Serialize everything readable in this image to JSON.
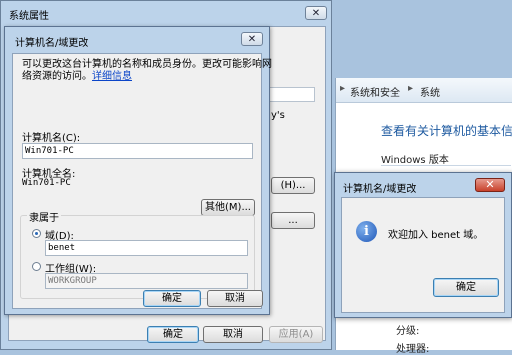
{
  "background_window": {
    "crumbs": [
      "系统和安全",
      "系统"
    ],
    "partial_text": "y's",
    "heading": "查看有关计算机的基本信息",
    "windows_version_label": "Windows 版本",
    "props": [
      "分级:",
      "处理器:"
    ]
  },
  "system_properties": {
    "title": "系统属性",
    "close_glyph": "✕",
    "partial_button_1": "(H)...",
    "partial_button_2": "...",
    "ok_label": "确定",
    "cancel_label": "取消",
    "apply_label": "应用(A)"
  },
  "computer_name_dialog": {
    "title": "计算机名/域更改",
    "close_glyph": "✕",
    "description": "可以更改这台计算机的名称和成员身份。更改可能影响网络资源的访问。",
    "description_line1": "可以更改这台计算机的名称和成员身份。更改可能影响网",
    "description_line2": "络资源的访问。",
    "details_link": "详细信息",
    "computer_name_label": "计算机名(C):",
    "computer_name_value": "Win701-PC",
    "full_name_label": "计算机全名:",
    "full_name_value": "Win701-PC",
    "more_button": "其他(M)...",
    "member_of_label": "隶属于",
    "domain_option": "域(D):",
    "domain_value": "benet",
    "workgroup_option": "工作组(W):",
    "workgroup_value": "WORKGROUP",
    "selected_option": "domain",
    "ok_label": "确定",
    "cancel_label": "取消"
  },
  "welcome_dialog": {
    "title": "计算机名/域更改",
    "close_glyph": "✕",
    "icon": "info-icon",
    "message": "欢迎加入 benet 域。",
    "ok_label": "确定"
  },
  "colors": {
    "title_bar": "#bcd3ea",
    "link": "#0b45c8",
    "heading": "#1e5aa0",
    "close_red": "#c8412b"
  }
}
